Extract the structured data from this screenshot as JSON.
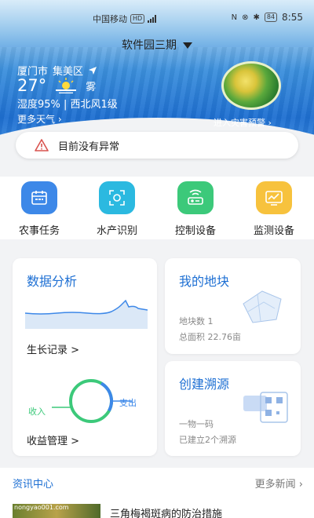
{
  "status_bar": {
    "carrier": "中国移动",
    "net": "HD",
    "battery": "84",
    "time": "8:55"
  },
  "header": {
    "location": "软件园三期"
  },
  "weather": {
    "city": "厦门市",
    "district": "集美区",
    "temperature": "27°",
    "condition": "雾",
    "humidity_wind": "湿度95% | 西北风1级",
    "more_label": "更多天气",
    "disaster_label": "进入灾害预警"
  },
  "alert": {
    "text": "目前没有异常"
  },
  "quick_actions": [
    {
      "label": "农事任务",
      "icon": "calendar-icon",
      "color": "#3d88e8"
    },
    {
      "label": "水产识别",
      "icon": "scan-icon",
      "color": "#2bb9e0"
    },
    {
      "label": "控制设备",
      "icon": "router-icon",
      "color": "#3cc97a"
    },
    {
      "label": "监测设备",
      "icon": "monitor-chart-icon",
      "color": "#f7c23d"
    }
  ],
  "cards": {
    "analysis": {
      "title": "数据分析",
      "link": "生长记录 >"
    },
    "income": {
      "title": "",
      "link": "收益管理 >",
      "in_label": "收入",
      "out_label": "支出"
    },
    "plots": {
      "title": "我的地块",
      "count": "地块数 1",
      "area": "总面积 22.76亩"
    },
    "trace": {
      "title": "创建溯源",
      "line1": "一物一码",
      "line2": "已建立2个溯源"
    }
  },
  "news": {
    "title": "资讯中心",
    "more": "更多新闻",
    "headline": "三角梅褐斑病的防治措施",
    "thumb_watermark": "nongyao001.com"
  },
  "colors": {
    "primary": "#1d6fd3",
    "warning": "#d9534f"
  }
}
